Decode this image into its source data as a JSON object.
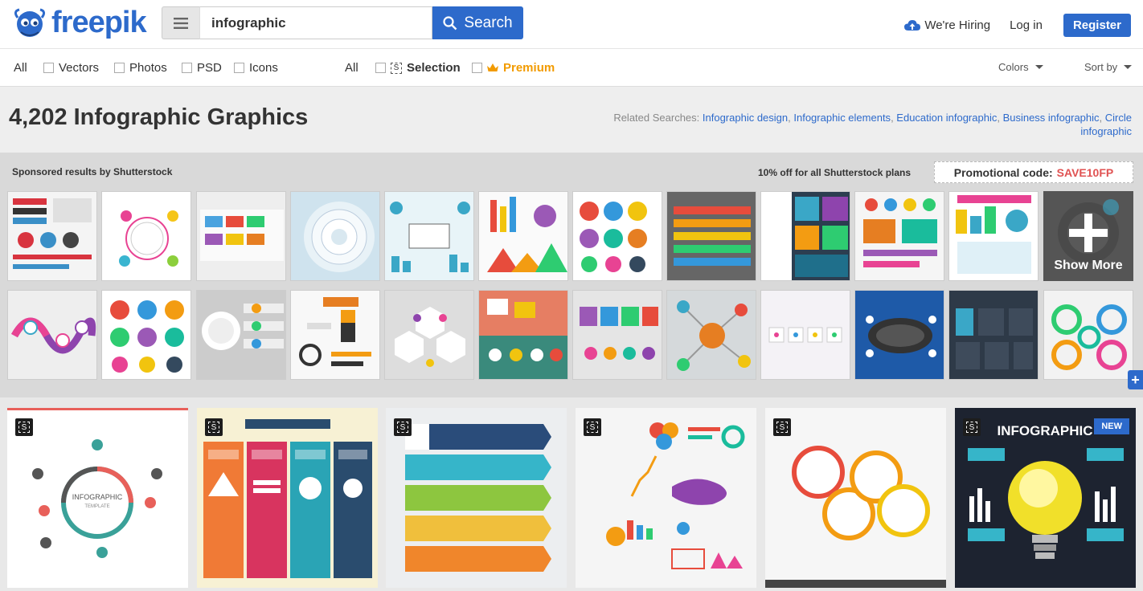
{
  "header": {
    "logo": "freepik",
    "search_value": "infographic",
    "search_label": "Search",
    "hiring": "We're Hiring",
    "login": "Log in",
    "register": "Register"
  },
  "filters": {
    "left": [
      "All",
      "Vectors",
      "Photos",
      "PSD",
      "Icons"
    ],
    "all2": "All",
    "selection": "Selection",
    "premium": "Premium",
    "colors": "Colors",
    "sort": "Sort by"
  },
  "title": {
    "heading": "4,202 Infographic Graphics",
    "related_label": "Related Searches:",
    "related": [
      "Infographic design",
      "Infographic elements",
      "Education infographic",
      "Business infographic",
      "Circle infographic"
    ]
  },
  "sponsored": {
    "label": "Sponsored results by Shutterstock",
    "offer": "10% off for all Shutterstock plans",
    "promo_label": "Promotional code:",
    "promo_code": "SAVE10FP",
    "show_more": "Show More"
  },
  "results": {
    "new_badge": "NEW",
    "selection_badge": "S"
  },
  "colors": {
    "brand": "#2d6acb",
    "premium": "#f29b00",
    "promo": "#e05252"
  },
  "icons": [
    "menu-icon",
    "search-icon",
    "cloud-upload-icon",
    "crown-icon",
    "selection-icon"
  ]
}
